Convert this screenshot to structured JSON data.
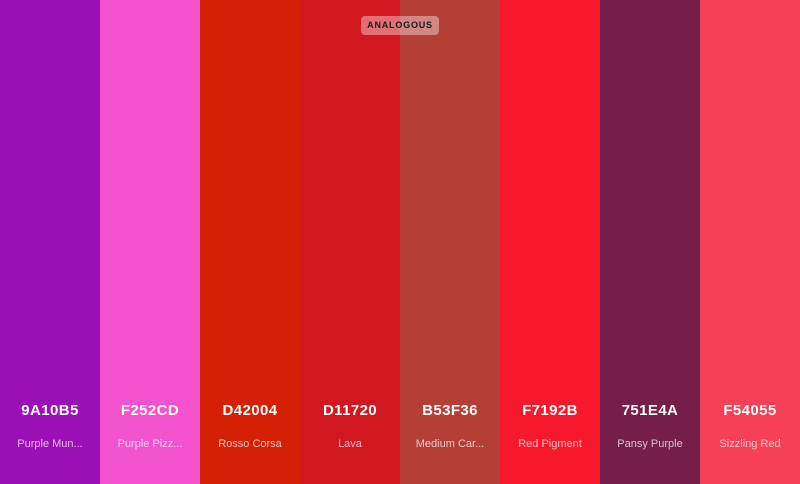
{
  "scheme": {
    "label": "ANALOGOUS"
  },
  "colors": [
    {
      "hex": "9A10B5",
      "name": "Purple Mun...",
      "color": "#9A10B5"
    },
    {
      "hex": "F252CD",
      "name": "Purple Pizz...",
      "color": "#F252CD"
    },
    {
      "hex": "D42004",
      "name": "Rosso Corsa",
      "color": "#D42004"
    },
    {
      "hex": "D11720",
      "name": "Lava",
      "color": "#D11720"
    },
    {
      "hex": "B53F36",
      "name": "Medium Car...",
      "color": "#B53F36"
    },
    {
      "hex": "F7192B",
      "name": "Red Pigment",
      "color": "#F7192B"
    },
    {
      "hex": "751E4A",
      "name": "Pansy Purple",
      "color": "#751E4A"
    },
    {
      "hex": "F54055",
      "name": "Sizzling Red",
      "color": "#F54055"
    }
  ]
}
